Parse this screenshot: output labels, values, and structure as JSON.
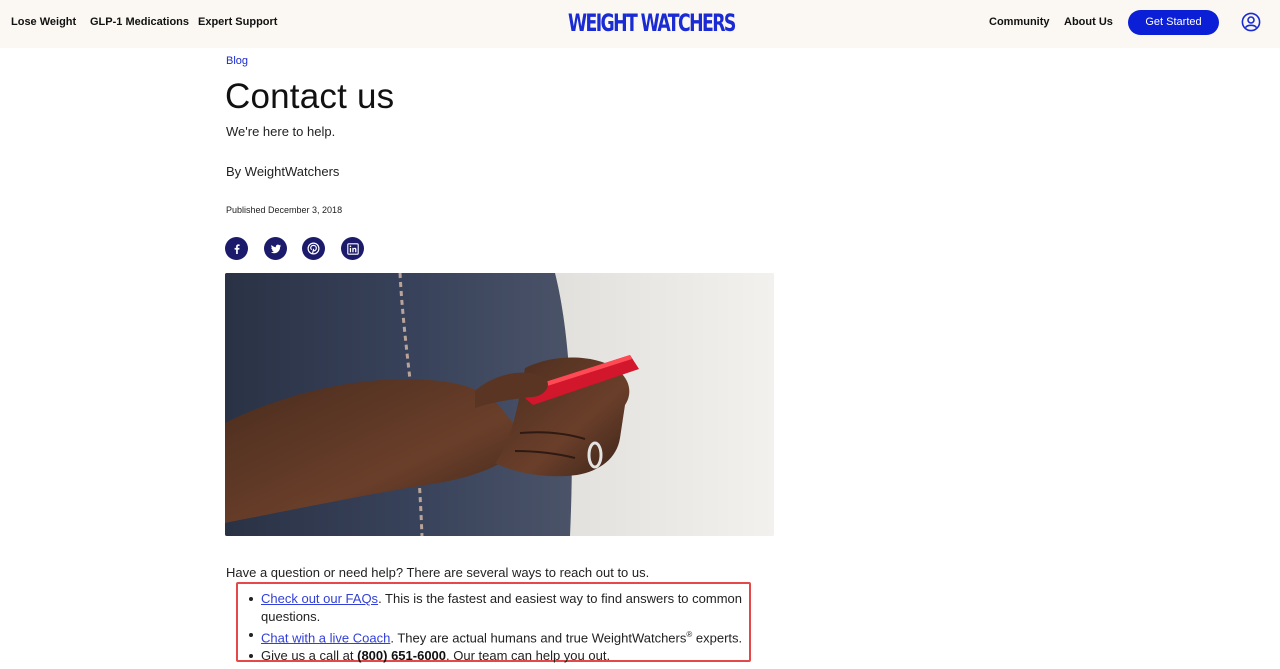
{
  "header": {
    "nav_left": [
      "Lose Weight",
      "GLP-1 Medications",
      "Expert Support"
    ],
    "logo_text": "WEIGHT WATCHERS",
    "nav_right": [
      "Community",
      "About Us"
    ],
    "cta_label": "Get Started",
    "account_icon": "account-circle-icon"
  },
  "article": {
    "breadcrumb": "Blog",
    "title": "Contact us",
    "subtitle": "We're here to help.",
    "byline": "By WeightWatchers",
    "published": "Published December 3, 2018",
    "share_icons": [
      "facebook-icon",
      "twitter-icon",
      "pinterest-icon",
      "linkedin-icon"
    ],
    "hero_image": "person-holding-red-phone",
    "intro": "Have a question or need help? There are several ways to reach out to us.",
    "ways": {
      "faq_link": "Check out our FAQs",
      "faq_text": ". This is the fastest and easiest way to find answers to common questions.",
      "coach_link": "Chat with a live Coach",
      "coach_text_before": ". They are actual humans and true WeightWatchers",
      "coach_reg": "®",
      "coach_text_after": " experts.",
      "call_before": "Give us a call at ",
      "call_phone": "(800) 651-6000",
      "call_after": ". Our team can help you out."
    }
  },
  "colors": {
    "brand_blue": "#1a2bd3",
    "cta_blue": "#0a1fd6",
    "share_navy": "#1b1a6b",
    "link_blue": "#3240d8",
    "callout_red": "#e54848",
    "header_bg": "#fbf8f3"
  }
}
